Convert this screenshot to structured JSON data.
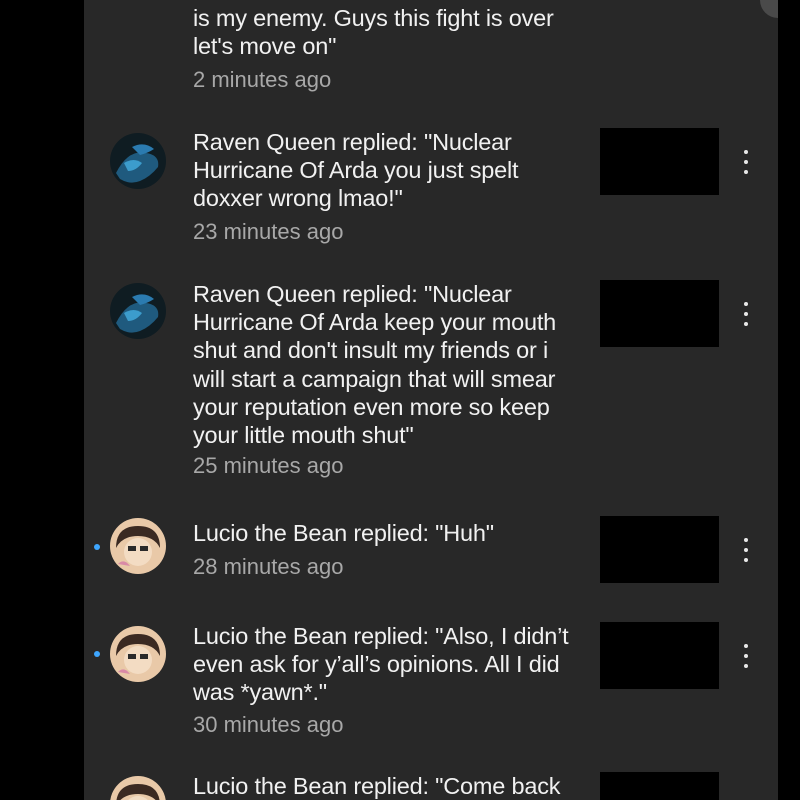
{
  "notifications": [
    {
      "text_lines": [
        "is my enemy. Guys this fight is over",
        "let's move on\""
      ],
      "time": "2 minutes ago"
    },
    {
      "text_lines": [
        "Raven Queen replied: \"Nuclear",
        "Hurricane Of Arda you just spelt",
        "doxxer wrong lmao!\""
      ],
      "time": "23 minutes ago",
      "avatar": "raven-queen-avatar",
      "unread": false
    },
    {
      "text_lines": [
        "Raven Queen replied: \"Nuclear",
        "Hurricane Of Arda keep your mouth",
        "shut and don't insult my friends or i",
        "will start a campaign that will smear",
        "your reputation even more so keep",
        "your little mouth shut\""
      ],
      "time": "25 minutes ago",
      "avatar": "raven-queen-avatar",
      "unread": false
    },
    {
      "text_lines": [
        "Lucio the Bean replied: \"Huh\""
      ],
      "time": "28 minutes ago",
      "avatar": "lucio-the-bean-avatar",
      "unread": true
    },
    {
      "text_lines": [
        "Lucio the Bean replied: \"Also, I didn’t",
        "even ask for y’all’s opinions. All I did",
        "was *yawn*.\""
      ],
      "time": "30 minutes ago",
      "avatar": "lucio-the-bean-avatar",
      "unread": true
    },
    {
      "text_lines": [
        "Lucio the Bean replied: \"Come back"
      ],
      "avatar": "lucio-the-bean-avatar",
      "unread": true
    }
  ],
  "icons": {
    "more": "more-vert-icon"
  },
  "colors": {
    "background": "#282828",
    "text": "#f1f1f1",
    "secondary_text": "#a8a8a8",
    "unread_dot": "#3ea6ff",
    "thumbnail": "#000000"
  }
}
